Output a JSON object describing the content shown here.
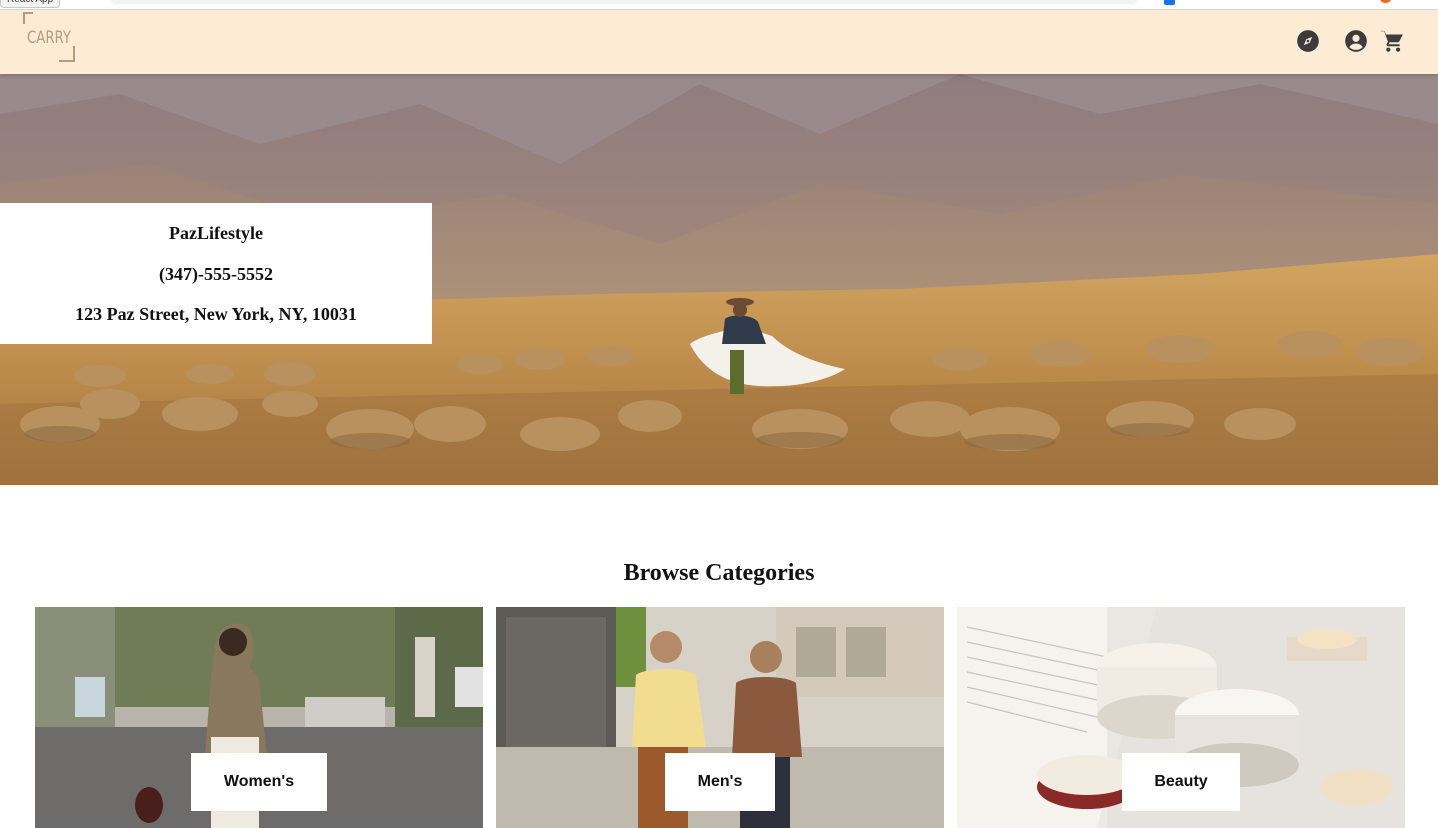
{
  "browser": {
    "devtools_tab": "React App"
  },
  "header": {
    "logo_text": "CARRY",
    "icons": [
      "compass-icon",
      "account-circle-icon",
      "shopping-cart-icon"
    ]
  },
  "hero": {
    "store_name": "PazLifestyle",
    "phone": "(347)-555-5552",
    "address": "123 Paz Street, New York, NY, 10031"
  },
  "categories": {
    "title": "Browse Categories",
    "items": [
      {
        "label": "Women's"
      },
      {
        "label": "Men's"
      },
      {
        "label": "Beauty"
      }
    ]
  },
  "colors": {
    "header_bg": "#fdebd6",
    "logo": "#b59c7e",
    "icon": "#3c3c3c"
  }
}
